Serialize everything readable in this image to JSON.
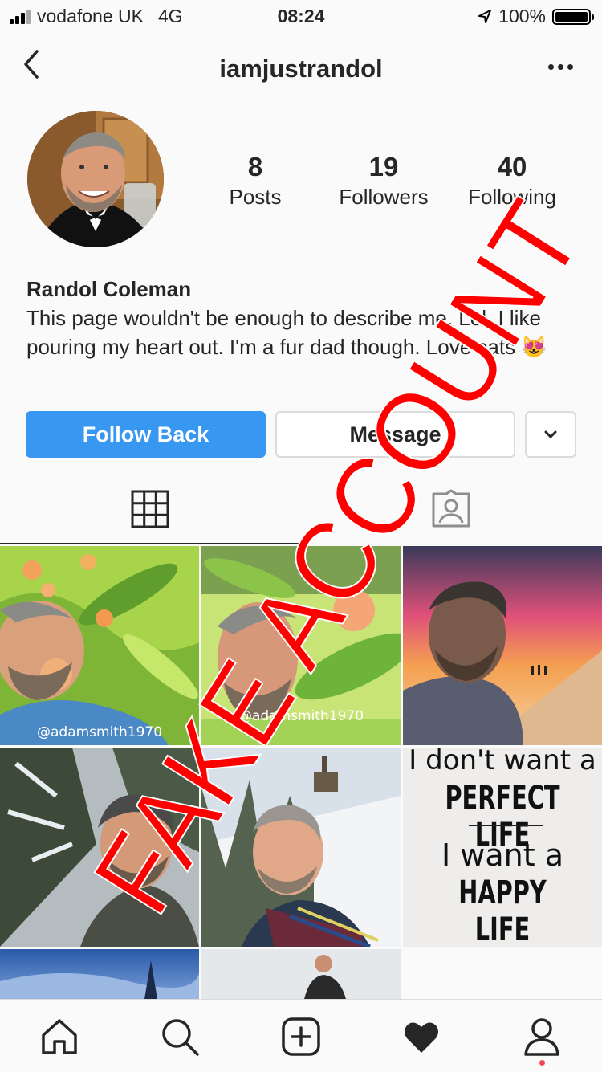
{
  "status_bar": {
    "carrier": "vodafone UK",
    "network": "4G",
    "time": "08:24",
    "battery": "100%",
    "battery_level": 1.0
  },
  "header": {
    "title": "iamjustrandol",
    "back_icon": "chevron-left-icon",
    "more_icon": "more-horizontal-icon"
  },
  "profile": {
    "stats": [
      {
        "value": "8",
        "label": "Posts"
      },
      {
        "value": "19",
        "label": "Followers"
      },
      {
        "value": "40",
        "label": "Following"
      }
    ],
    "name": "Randol Coleman",
    "bio": "This page wouldn't be enough to describe me. Lol. I like pouring my heart out. I'm a fur dad though. Love cats 😻"
  },
  "actions": {
    "follow_back": "Follow Back",
    "message": "Message"
  },
  "tabs": [
    {
      "icon": "grid-icon",
      "active": true
    },
    {
      "icon": "tagged-person-icon",
      "active": false
    }
  ],
  "posts": [
    {
      "caption": "@adamsmith1970"
    },
    {
      "caption": "@adamsmith1970"
    },
    {
      "caption": ""
    },
    {
      "caption": ""
    },
    {
      "caption": ""
    },
    {
      "text_lines": [
        "I don't want a",
        "PERFECT LIFE",
        "I want a",
        "HAPPY LIFE"
      ]
    },
    {
      "caption": ""
    },
    {
      "caption": ""
    }
  ],
  "overlay": {
    "stamp": "FAKE ACCOUNT",
    "color": "#ff0000"
  },
  "bottom_nav": [
    "home-icon",
    "search-icon",
    "new-post-icon",
    "activity-heart-icon",
    "profile-icon"
  ],
  "colors": {
    "accent": "#3897f0",
    "text": "#262626",
    "border": "#dbdbdb",
    "notification": "#ed4956"
  }
}
